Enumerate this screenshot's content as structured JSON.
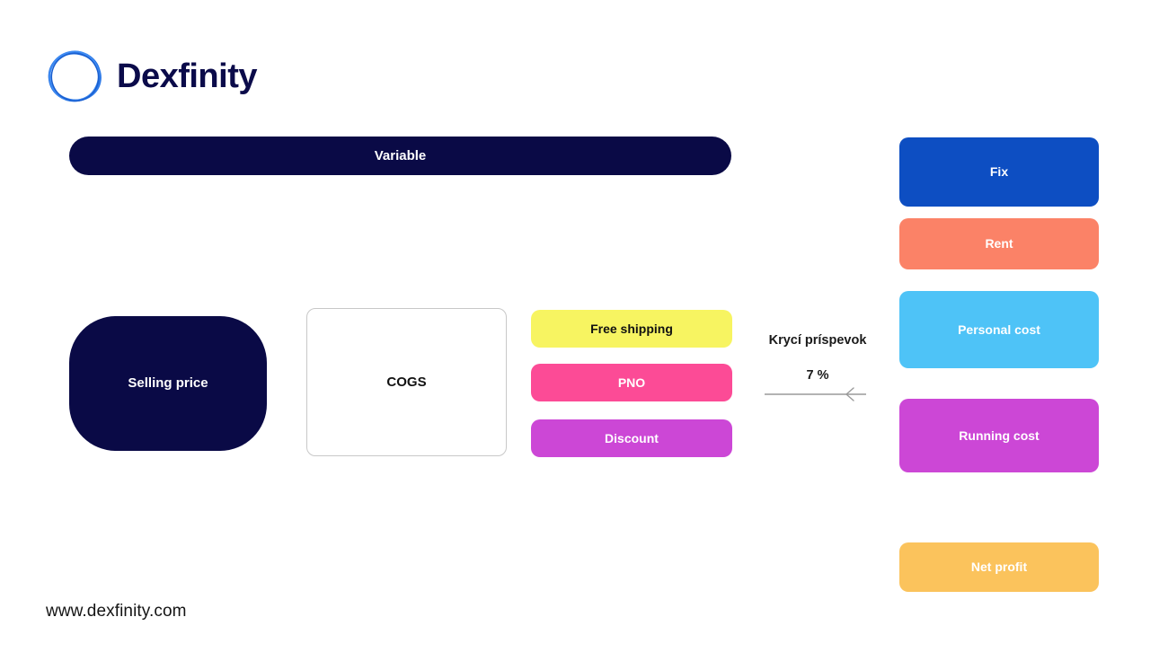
{
  "brand": {
    "name": "Dexfinity",
    "logo_icon": "sketch-circle-icon",
    "logo_color": "#1f6fe0",
    "name_color": "#0b0b4a"
  },
  "diagram": {
    "variable_bar": {
      "label": "Variable",
      "color": "#0a0a46",
      "text_color": "#ffffff"
    },
    "selling_price": {
      "label": "Selling price",
      "color": "#0a0a46",
      "text_color": "#ffffff"
    },
    "cogs": {
      "label": "COGS",
      "color": "#ffffff",
      "border_color": "#c8c8c8",
      "text_color": "#121212"
    },
    "variable_items": [
      {
        "label": "Free shipping",
        "color": "#f7f461",
        "text_color": "#111111"
      },
      {
        "label": "PNO",
        "color": "#fc4b96",
        "text_color": "#ffffff"
      },
      {
        "label": "Discount",
        "color": "#cc47d6",
        "text_color": "#ffffff"
      }
    ],
    "annotation": {
      "title": "Krycí príspevok",
      "value": "7 %",
      "arrow_direction": "left",
      "arrow_color": "#9a9a9a"
    },
    "fixed_items": [
      {
        "label": "Fix",
        "color": "#0d4ec2",
        "text_color": "#ffffff"
      },
      {
        "label": "Rent",
        "color": "#fb8267",
        "text_color": "#ffffff"
      },
      {
        "label": "Personal cost",
        "color": "#4ec3f7",
        "text_color": "#ffffff"
      },
      {
        "label": "Running cost",
        "color": "#cc47d6",
        "text_color": "#ffffff"
      },
      {
        "label": "Net profit",
        "color": "#fbc35c",
        "text_color": "#ffffff"
      }
    ]
  },
  "footer": {
    "url": "www.dexfinity.com"
  }
}
